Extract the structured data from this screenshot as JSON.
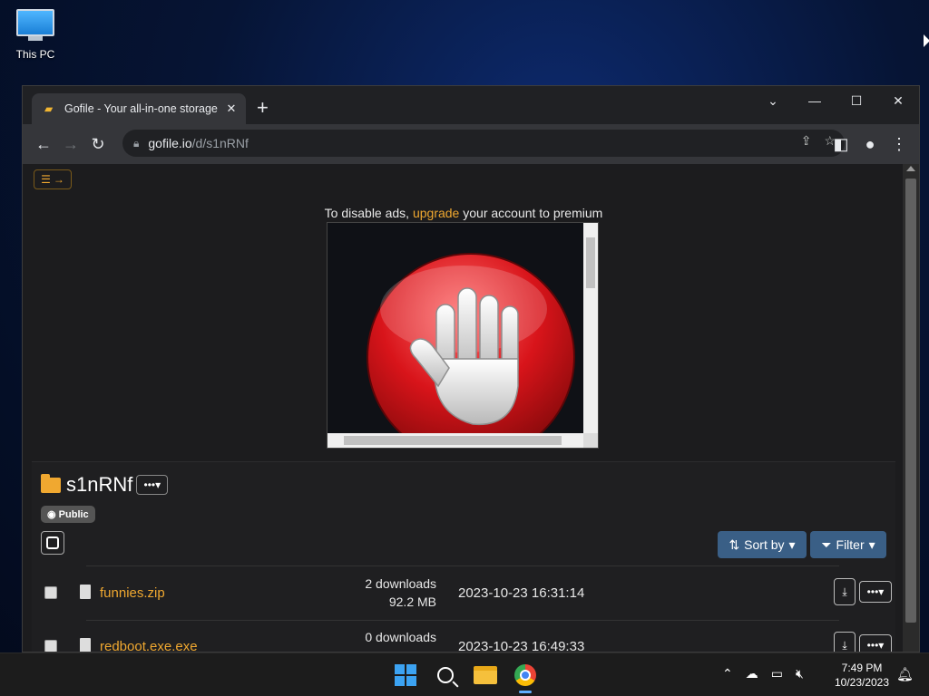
{
  "desktop": {
    "icon_label": "This PC"
  },
  "browser": {
    "tab_title": "Gofile - Your all-in-one storage",
    "tab_close": "✕",
    "new_tab": "+",
    "window_controls": {
      "dropdown": "⌄",
      "minimize": "—",
      "maximize": "☐",
      "close": "✕"
    },
    "url_host": "gofile.io",
    "url_path": "/d/s1nRNf"
  },
  "page": {
    "ad_notice_prefix": "To disable ads, ",
    "ad_notice_link": "upgrade",
    "ad_notice_suffix": " your account to premium",
    "folder_name": "s1nRNf",
    "visibility_badge": "Public",
    "sort_label": "Sort by",
    "filter_label": "Filter",
    "files": [
      {
        "name": "funnies.zip",
        "downloads": "2 downloads",
        "size": "92.2 MB",
        "date": "2023-10-23 16:31:14"
      },
      {
        "name": "redboot.exe.exe",
        "downloads": "0 downloads",
        "size": "",
        "date": "2023-10-23 16:49:33"
      }
    ]
  },
  "taskbar": {
    "time": "7:49 PM",
    "date": "10/23/2023"
  },
  "colors": {
    "accent": "#f0a830",
    "button_blue": "#3a5f86",
    "page_bg": "#1c1c1e"
  }
}
